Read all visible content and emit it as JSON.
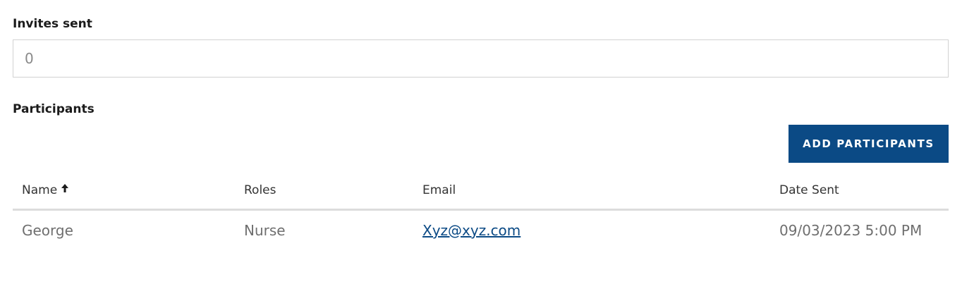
{
  "invites": {
    "label": "Invites sent",
    "value": "0"
  },
  "participants": {
    "label": "Participants",
    "add_button": "ADD PARTICIPANTS",
    "columns": {
      "name": "Name",
      "roles": "Roles",
      "email": "Email",
      "date_sent": "Date Sent"
    },
    "sort": {
      "column": "name",
      "direction": "ascending",
      "icon": "arrow-up-icon"
    },
    "rows": [
      {
        "name": "George",
        "role": "Nurse",
        "email": "Xyz@xyz.com",
        "date_sent": "09/03/2023 5:00 PM"
      }
    ]
  },
  "colors": {
    "primary_button": "#0b4a85",
    "link": "#0b4a85",
    "muted_text": "#6f6f6f",
    "border": "#d2d2d2"
  }
}
